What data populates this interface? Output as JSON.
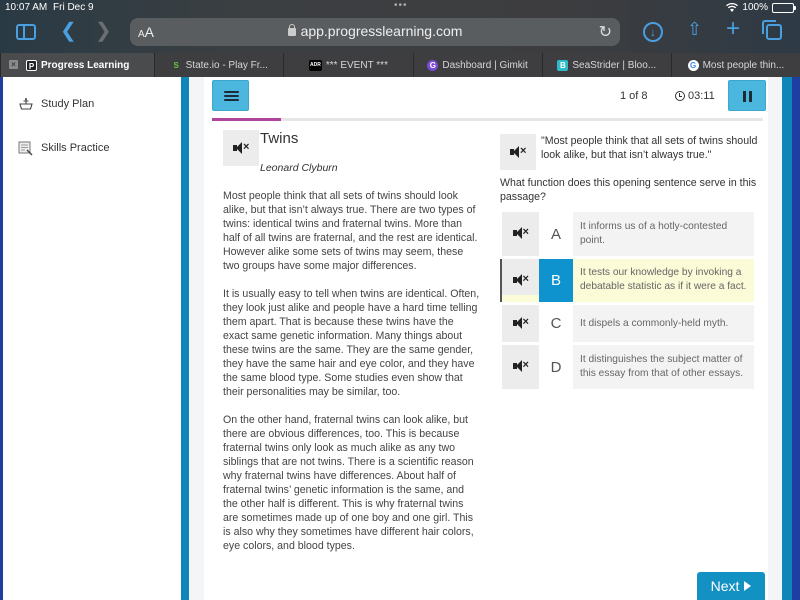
{
  "status_bar": {
    "time": "10:07 AM",
    "date": "Fri Dec 9",
    "battery": "100%"
  },
  "browser": {
    "text_size_label": "AA",
    "url": "app.progresslearning.com",
    "tabs": [
      {
        "title": "Progress Learning",
        "favicon": "P",
        "active": true
      },
      {
        "title": "State.io - Play Fr...",
        "favicon": "S"
      },
      {
        "title": "*** EVENT ***",
        "favicon": "ADR"
      },
      {
        "title": "Dashboard | Gimkit",
        "favicon": "G"
      },
      {
        "title": "SeaStrider | Bloo...",
        "favicon": "B"
      },
      {
        "title": "Most people thin...",
        "favicon": "G"
      }
    ]
  },
  "sidebar": {
    "items": [
      {
        "label": "Study Plan",
        "icon": "crown-icon"
      },
      {
        "label": "Skills Practice",
        "icon": "practice-icon"
      }
    ]
  },
  "quiz": {
    "progress_text": "1 of 8",
    "question_index": 1,
    "question_total": 8,
    "progress_fraction": 0.125,
    "timer": "03:11",
    "accent_color": "#b0449c",
    "button_color": "#4bb7de",
    "next_label": "Next"
  },
  "passage": {
    "title": "Twins",
    "author": "Leonard Clyburn",
    "paragraphs": [
      "Most people think that all sets of twins should look alike, but that isn’t always true. There are two types of twins: identical twins and fraternal twins. More than half of all twins are fraternal, and the rest are identical. However alike some sets of twins may seem, these two groups have some major differences.",
      "It is usually easy to tell when twins are identical. Often, they look just alike and people have a hard time telling them apart. That is because these twins have the exact same genetic information. Many things about these twins are the same. They are the same gender, they have the same hair and eye color, and they have the same blood type. Some studies even show that their personalities may be similar, too.",
      "On the other hand, fraternal twins can look alike, but there are obvious differences, too. This is because fraternal twins only look as much alike as any two siblings that are not twins. There is a scientific reason why fraternal twins have differences. About half of fraternal twins’ genetic information is the same, and the other half is different. This is why fraternal twins are sometimes made up of one boy and one girl. This is also why they sometimes have different hair colors, eye colors, and blood types."
    ]
  },
  "question": {
    "quote": "\"Most people think that all sets of twins should look alike, but that isn’t always true.\"",
    "prompt": "What function does this opening sentence serve in this passage?",
    "selected": "B",
    "choices": [
      {
        "letter": "A",
        "text": "It informs us of a hotly-contested point."
      },
      {
        "letter": "B",
        "text": "It tests our knowledge by invoking a debatable statistic as if it were a fact."
      },
      {
        "letter": "C",
        "text": "It dispels a commonly-held myth."
      },
      {
        "letter": "D",
        "text": "It distinguishes the subject matter of this essay from that of other essays."
      }
    ]
  }
}
